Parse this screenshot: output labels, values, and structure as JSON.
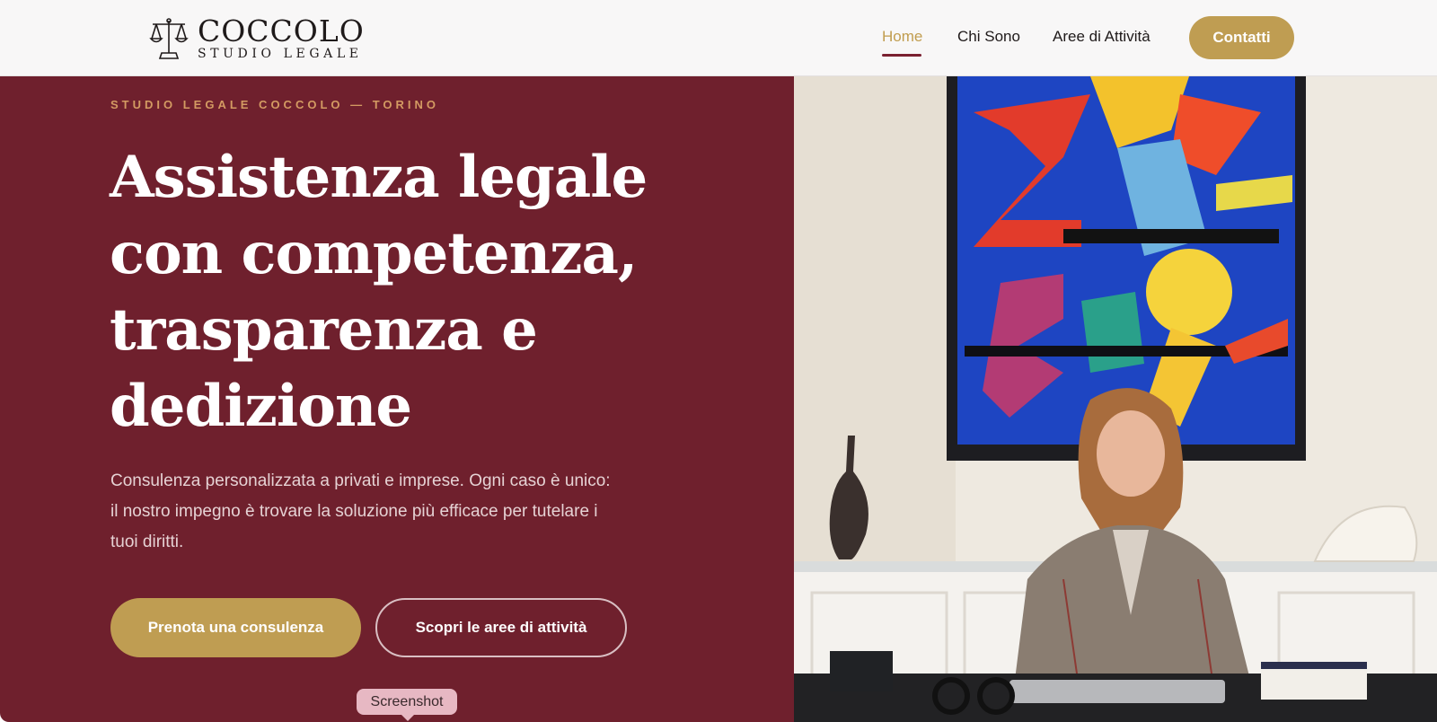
{
  "header": {
    "logo": {
      "name": "COCCOLO",
      "subtitle": "STUDIO LEGALE",
      "icon": "scales-of-justice-icon"
    },
    "nav": {
      "items": [
        {
          "label": "Home",
          "active": true
        },
        {
          "label": "Chi Sono",
          "active": false
        },
        {
          "label": "Aree di Attività",
          "active": false
        }
      ],
      "cta_label": "Contatti"
    }
  },
  "hero": {
    "eyebrow": "STUDIO LEGALE COCCOLO — TORINO",
    "headline": "Assistenza legale con competenza, trasparenza e dedizione",
    "lead": "Consulenza personalizzata a privati e imprese. Ogni caso è unico: il nostro impegno è trovare la soluzione più efficace per tutelare i tuoi diritti.",
    "primary_button": "Prenota una consulenza",
    "secondary_button": "Scopri le aree di attività",
    "tooltip": "Screenshot",
    "image": "lawyer-office-portrait"
  },
  "colors": {
    "burgundy": "#6f202d",
    "gold": "#bf9d52",
    "eyebrow": "#d39a62",
    "nav_active": "#c19d4f",
    "header_bg": "#f8f7f7"
  }
}
